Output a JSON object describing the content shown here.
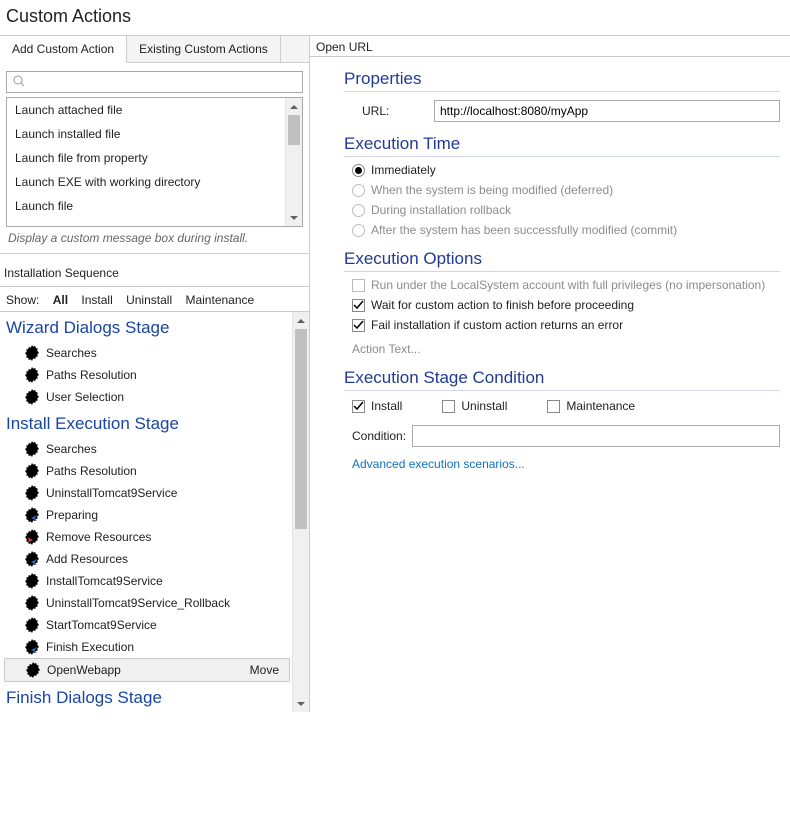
{
  "title": "Custom Actions",
  "tabs": {
    "add": "Add Custom Action",
    "existing": "Existing Custom Actions"
  },
  "search": {
    "placeholder": ""
  },
  "action_list": [
    "Launch attached file",
    "Launch installed file",
    "Launch file from property",
    "Launch EXE with working directory",
    "Launch file"
  ],
  "hint": "Display a custom message box during install.",
  "sequence": {
    "title": "Installation Sequence",
    "filter_label": "Show:",
    "filters": {
      "all": "All",
      "install": "Install",
      "uninstall": "Uninstall",
      "maintenance": "Maintenance"
    },
    "stages": {
      "wizard": {
        "title": "Wizard Dialogs Stage",
        "items": [
          "Searches",
          "Paths Resolution",
          "User Selection"
        ]
      },
      "install": {
        "title": "Install Execution Stage",
        "items": [
          "Searches",
          "Paths Resolution",
          "UninstallTomcat9Service",
          "Preparing",
          "Remove Resources",
          "Add Resources",
          "InstallTomcat9Service",
          "UninstallTomcat9Service_Rollback",
          "StartTomcat9Service",
          "Finish Execution"
        ],
        "selected": "OpenWebapp",
        "moveLabel": "Move"
      },
      "finish": {
        "title": "Finish Dialogs Stage"
      }
    }
  },
  "details": {
    "name": "Open URL",
    "properties": {
      "title": "Properties",
      "url_label": "URL:",
      "url": "http://localhost:8080/myApp"
    },
    "exec_time": {
      "title": "Execution Time",
      "immediately": "Immediately",
      "deferred": "When the system is being modified (deferred)",
      "rollback": "During installation rollback",
      "commit": "After the system has been successfully modified (commit)"
    },
    "exec_opts": {
      "title": "Execution Options",
      "localsystem": "Run under the LocalSystem account with full privileges (no impersonation)",
      "wait": "Wait for custom action to finish before proceeding",
      "fail": "Fail installation if custom action returns an error",
      "action_text": "Action Text..."
    },
    "stage_cond": {
      "title": "Execution Stage Condition",
      "install": "Install",
      "uninstall": "Uninstall",
      "maintenance": "Maintenance",
      "condition_label": "Condition:",
      "condition": "",
      "adv": "Advanced execution scenarios..."
    }
  }
}
